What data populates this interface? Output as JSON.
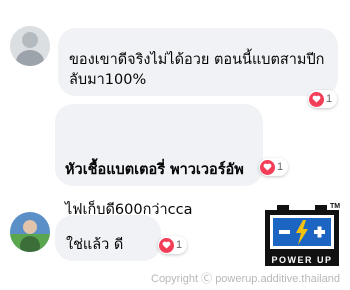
{
  "comments": [
    {
      "text": "ของเขาดีจริงไม่ได้อวย ตอนนี้แบตสามปีก\nลับมา100%",
      "reaction_count": "1"
    },
    {
      "bold_text": "หัวเชื้อแบตเตอรี่ พาวเวอร์อัพ",
      "text": "ไฟเก็บดี600กว่าcca",
      "reaction_count": "1"
    },
    {
      "text": "ใช่แล้ว ดี",
      "reaction_count": "1"
    }
  ],
  "reaction_type": "heart-icon",
  "colors": {
    "bubble": "#f0f2f5",
    "heart": "#f33e58",
    "logo_accent": "#1d65c2",
    "logo_bolt": "#f4c20d"
  },
  "watermark": {
    "text": "Copyright Ⓒ powerup.additive.thailand",
    "logo_label": "POWER UP",
    "logo_tm": "TM"
  }
}
